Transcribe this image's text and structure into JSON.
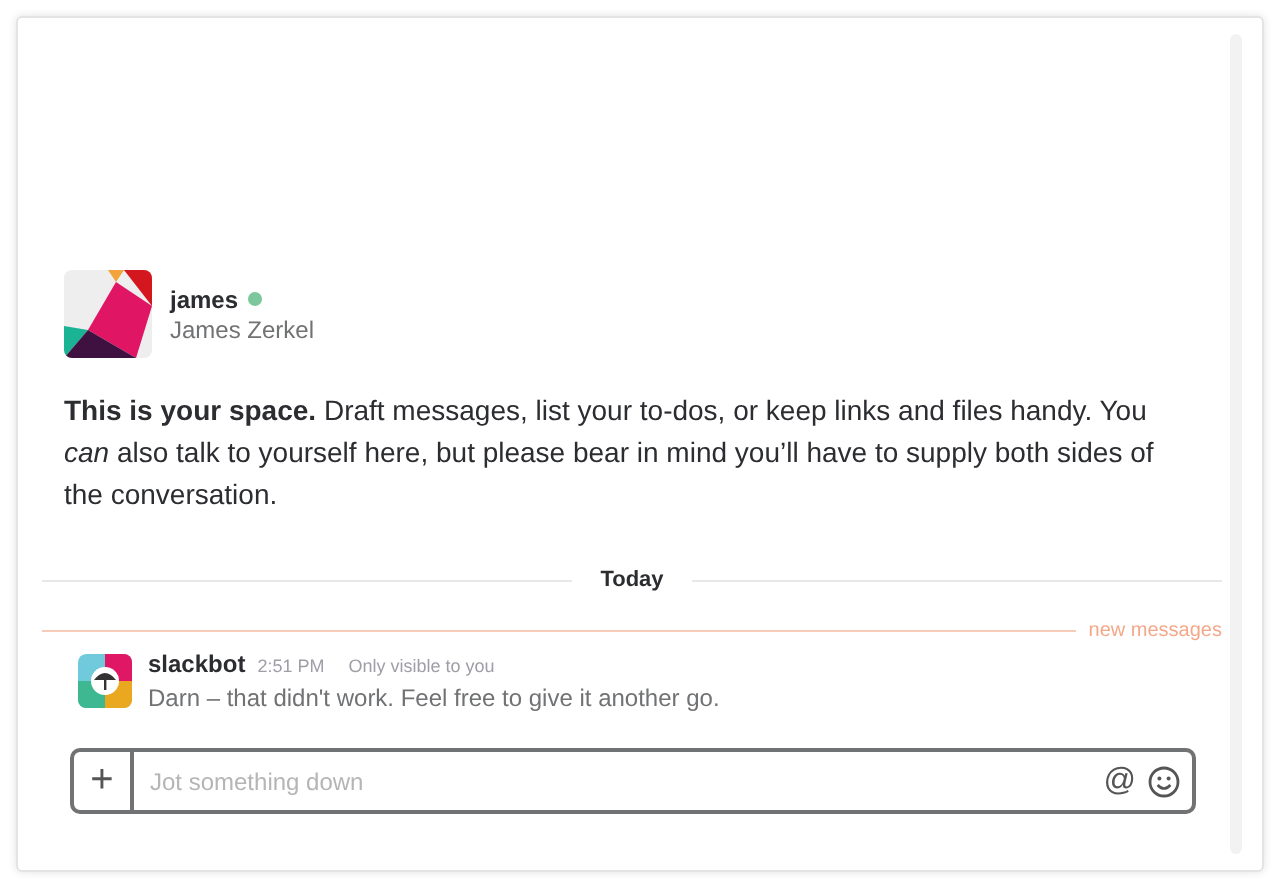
{
  "profile": {
    "username": "james",
    "online": true,
    "full_name": "James Zerkel"
  },
  "intro": "**This is your space.** Draft messages, list your to-dos, or keep links and files handy. You *can* also talk to yourself here, but please bear in mind you’ll have to supply both sides of the conversation.",
  "day_divider": "Today",
  "new_messages_label": "new messages",
  "messages": [
    {
      "sender": "slackbot",
      "time": "2:51 PM",
      "note": "Only visible to you",
      "text": "Darn – that didn't work. Feel free to give it another go."
    }
  ],
  "composer": {
    "plus": "+",
    "placeholder": "Jot something down",
    "mention": "@"
  }
}
